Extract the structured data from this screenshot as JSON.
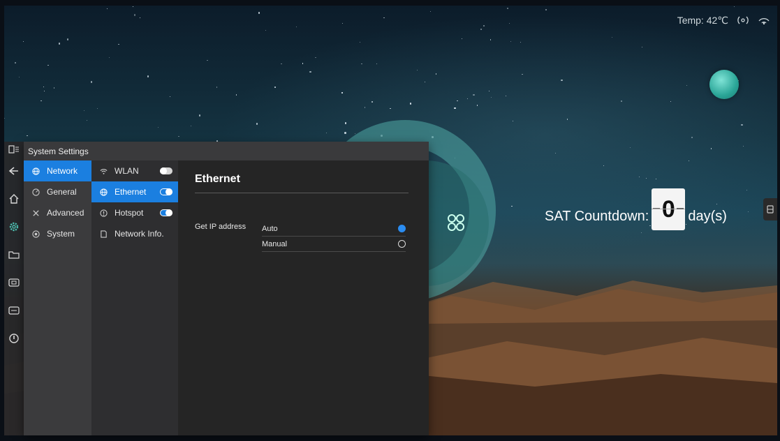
{
  "status": {
    "temp_label": "Temp:",
    "temp_value": "42℃"
  },
  "countdown": {
    "label": "SAT Countdown:",
    "digit": "0",
    "suffix": "day(s)"
  },
  "window": {
    "title": "System Settings"
  },
  "categories": [
    {
      "label": "Network",
      "icon": "globe-icon",
      "active": true
    },
    {
      "label": "General",
      "icon": "gauge-icon",
      "active": false
    },
    {
      "label": "Advanced",
      "icon": "tools-icon",
      "active": false
    },
    {
      "label": "System",
      "icon": "circle-icon",
      "active": false
    }
  ],
  "network_items": [
    {
      "label": "WLAN",
      "icon": "wifi-icon",
      "toggle": "off",
      "active": false
    },
    {
      "label": "Ethernet",
      "icon": "globe-icon",
      "toggle": "on",
      "active": true
    },
    {
      "label": "Hotspot",
      "icon": "hotspot-icon",
      "toggle": "on",
      "active": false
    },
    {
      "label": "Network Info.",
      "icon": "document-icon",
      "toggle": null,
      "active": false
    }
  ],
  "pane": {
    "title": "Ethernet",
    "ip_label": "Get IP address",
    "options": [
      {
        "label": "Auto",
        "selected": true
      },
      {
        "label": "Manual",
        "selected": false
      }
    ]
  },
  "colors": {
    "accent": "#1b7fe0",
    "teal": "#2aa597"
  }
}
